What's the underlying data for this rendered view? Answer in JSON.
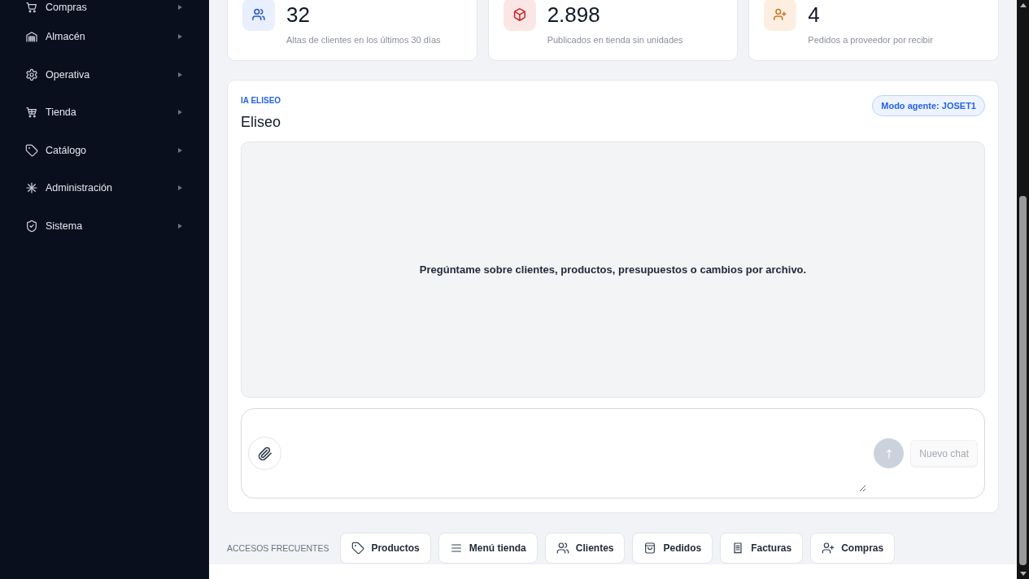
{
  "sidebar": {
    "items": [
      {
        "label": "Compras"
      },
      {
        "label": "Almacén"
      },
      {
        "label": "Operativa"
      },
      {
        "label": "Tienda"
      },
      {
        "label": "Catálogo"
      },
      {
        "label": "Administración"
      },
      {
        "label": "Sistema"
      }
    ]
  },
  "stats": [
    {
      "value": "32",
      "caption": "Altas de clientes en los últimos 30 días",
      "color": "#e9effd"
    },
    {
      "value": "2.898",
      "caption": "Publicados en tienda sin unidades",
      "color": "#fbe6e6"
    },
    {
      "value": "4",
      "caption": "Pedidos a proveedor por recibir",
      "color": "#fcefe2"
    }
  ],
  "assistant": {
    "eyebrow": "IA ELISEO",
    "title": "Eliseo",
    "mode_badge": "Modo agente: JOSET1",
    "empty_message": "Pregúntame sobre clientes, productos, presupuestos o cambios por archivo.",
    "composer": {
      "send_button": {
        "disabled": true
      },
      "new_chat_button": {
        "label": "Nuevo chat",
        "disabled": true
      }
    }
  },
  "quick_access": {
    "title": "ACCESOS FRECUENTES",
    "links": [
      {
        "label": "Productos"
      },
      {
        "label": "Menú tienda"
      },
      {
        "label": "Clientes"
      },
      {
        "label": "Pedidos"
      },
      {
        "label": "Facturas"
      },
      {
        "label": "Compras"
      }
    ]
  }
}
